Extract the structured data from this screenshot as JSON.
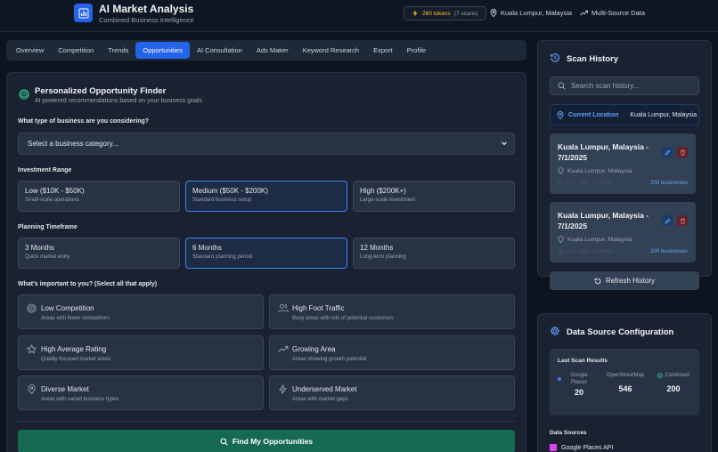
{
  "header": {
    "title": "AI Market Analysis",
    "subtitle": "Combined Business Intelligence",
    "tokens": "260 tokens",
    "scans": "(7 scans)",
    "location": "Kuala Lumpur, Malaysia",
    "source": "Multi-Source Data"
  },
  "tabs": [
    {
      "label": "Overview"
    },
    {
      "label": "Competition"
    },
    {
      "label": "Trends"
    },
    {
      "label": "Opportunities"
    },
    {
      "label": "AI Consultation"
    },
    {
      "label": "Ads Maker"
    },
    {
      "label": "Keyword Research"
    },
    {
      "label": "Export"
    },
    {
      "label": "Profile"
    }
  ],
  "finder": {
    "title": "Personalized Opportunity Finder",
    "subtitle": "AI-powered recommendations based on your business goals",
    "business_question": "What type of business are you considering?",
    "business_select": "Select a business category...",
    "investment_label": "Investment Range",
    "investment": [
      {
        "title": "Low ($10K - $50K)",
        "sub": "Small-scale operations"
      },
      {
        "title": "Medium ($50K - $200K)",
        "sub": "Standard business setup"
      },
      {
        "title": "High ($200K+)",
        "sub": "Large-scale investment"
      }
    ],
    "timeframe_label": "Planning Timeframe",
    "timeframe": [
      {
        "title": "3 Months",
        "sub": "Quick market entry"
      },
      {
        "title": "6 Months",
        "sub": "Standard planning period"
      },
      {
        "title": "12 Months",
        "sub": "Long-term planning"
      }
    ],
    "priorities_label": "What's important to you? (Select all that apply)",
    "priorities": [
      {
        "title": "Low Competition",
        "sub": "Areas with fewer competitors",
        "icon": "target-icon"
      },
      {
        "title": "High Foot Traffic",
        "sub": "Busy areas with lots of potential customers",
        "icon": "users-icon"
      },
      {
        "title": "High Average Rating",
        "sub": "Quality-focused market areas",
        "icon": "star-icon"
      },
      {
        "title": "Growing Area",
        "sub": "Areas showing growth potential",
        "icon": "trending-up-icon"
      },
      {
        "title": "Diverse Market",
        "sub": "Areas with varied business types",
        "icon": "map-pin-icon"
      },
      {
        "title": "Underserved Market",
        "sub": "Areas with market gaps",
        "icon": "zap-icon"
      }
    ],
    "button": "Find My Opportunities"
  },
  "history": {
    "title": "Scan History",
    "search_placeholder": "Search scan history...",
    "current_label": "Current Location",
    "current_value": "Kuala Lumpur, Malaysia",
    "items": [
      {
        "title": "Kuala Lumpur, Malaysia - 7/1/2025",
        "location": "Kuala Lumpur, Malaysia",
        "date": "Jul 1, 2025, 02:42 AM",
        "count": "200 businesses"
      },
      {
        "title": "Kuala Lumpur, Malaysia - 7/1/2025",
        "location": "Kuala Lumpur, Malaysia",
        "date": "Jul 1, 2025, 02:38 AM",
        "count": "200 businesses"
      }
    ],
    "refresh": "Refresh History"
  },
  "datasource": {
    "title": "Data Source Configuration",
    "last_scan": "Last Scan Results",
    "google_label": "Google Places",
    "google_value": "20",
    "osm_label": "OpenStreetMap",
    "osm_value": "546",
    "combined_label": "Combined",
    "combined_value": "200",
    "sources_label": "Data Sources",
    "google_api": "Google Places API"
  },
  "colors": {
    "accent": "#2563eb",
    "primary_button": "#166a52",
    "token": "#fbbf24"
  }
}
